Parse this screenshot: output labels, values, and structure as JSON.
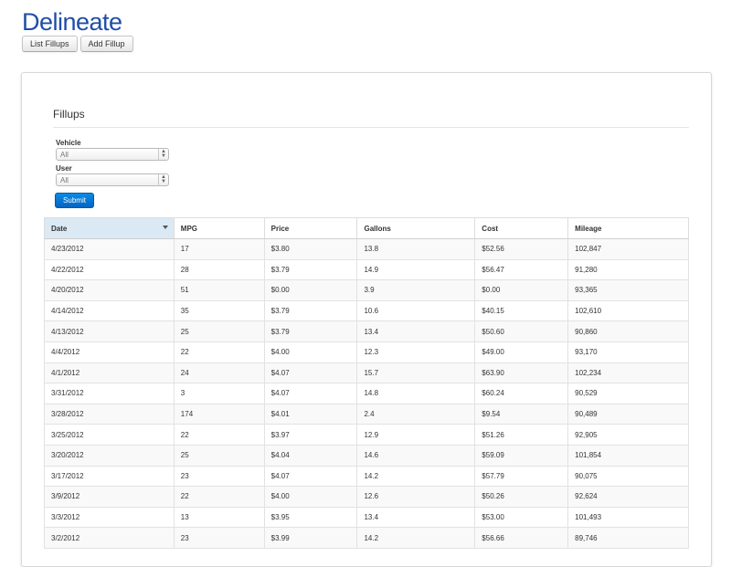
{
  "app": {
    "title": "Delineate"
  },
  "nav": {
    "list_fillups": "List Fillups",
    "add_fillup": "Add Fillup"
  },
  "panel": {
    "heading": "Fillups"
  },
  "filters": {
    "vehicle_label": "Vehicle",
    "vehicle_value": "All",
    "user_label": "User",
    "user_value": "All",
    "submit_label": "Submit"
  },
  "table": {
    "sorted_column": "Date",
    "sort_direction": "descending",
    "columns": [
      "Date",
      "MPG",
      "Price",
      "Gallons",
      "Cost",
      "Mileage"
    ],
    "rows": [
      [
        "4/23/2012",
        "17",
        "$3.80",
        "13.8",
        "$52.56",
        "102,847"
      ],
      [
        "4/22/2012",
        "28",
        "$3.79",
        "14.9",
        "$56.47",
        "91,280"
      ],
      [
        "4/20/2012",
        "51",
        "$0.00",
        "3.9",
        "$0.00",
        "93,365"
      ],
      [
        "4/14/2012",
        "35",
        "$3.79",
        "10.6",
        "$40.15",
        "102,610"
      ],
      [
        "4/13/2012",
        "25",
        "$3.79",
        "13.4",
        "$50.60",
        "90,860"
      ],
      [
        "4/4/2012",
        "22",
        "$4.00",
        "12.3",
        "$49.00",
        "93,170"
      ],
      [
        "4/1/2012",
        "24",
        "$4.07",
        "15.7",
        "$63.90",
        "102,234"
      ],
      [
        "3/31/2012",
        "3",
        "$4.07",
        "14.8",
        "$60.24",
        "90,529"
      ],
      [
        "3/28/2012",
        "174",
        "$4.01",
        "2.4",
        "$9.54",
        "90,489"
      ],
      [
        "3/25/2012",
        "22",
        "$3.97",
        "12.9",
        "$51.26",
        "92,905"
      ],
      [
        "3/20/2012",
        "25",
        "$4.04",
        "14.6",
        "$59.09",
        "101,854"
      ],
      [
        "3/17/2012",
        "23",
        "$4.07",
        "14.2",
        "$57.79",
        "90,075"
      ],
      [
        "3/9/2012",
        "22",
        "$4.00",
        "12.6",
        "$50.26",
        "92,624"
      ],
      [
        "3/3/2012",
        "13",
        "$3.95",
        "13.4",
        "$53.00",
        "101,493"
      ],
      [
        "3/2/2012",
        "23",
        "$3.99",
        "14.2",
        "$56.66",
        "89,746"
      ]
    ]
  }
}
